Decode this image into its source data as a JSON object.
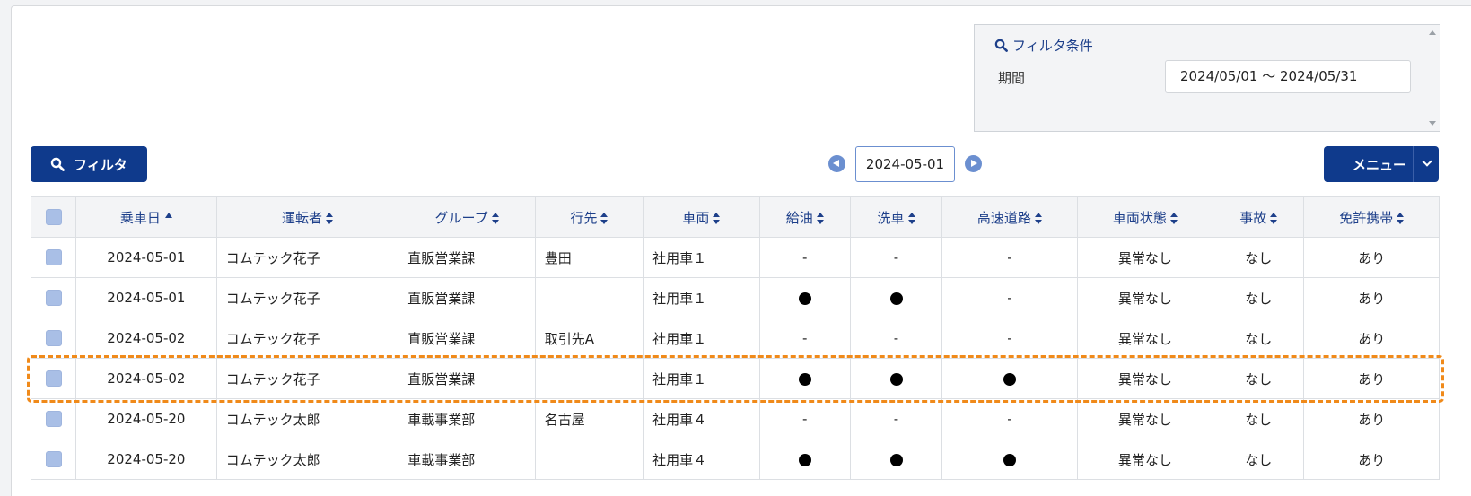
{
  "filter_panel": {
    "title": "フィルタ条件",
    "period_label": "期間",
    "period_value": "2024/05/01 〜 2024/05/31"
  },
  "toolbar": {
    "filter_button": "フィルタ",
    "current_date": "2024-05-01",
    "menu_button": "メニュー"
  },
  "table": {
    "headers": [
      "乗車日",
      "運転者",
      "グループ",
      "行先",
      "車両",
      "給油",
      "洗車",
      "高速道路",
      "車両状態",
      "事故",
      "免許携帯"
    ],
    "rows": [
      {
        "date": "2024-05-01",
        "driver": "コムテック花子",
        "group": "直販営業課",
        "destination": "豊田",
        "vehicle": "社用車１",
        "fuel": "-",
        "wash": "-",
        "highway": "-",
        "condition": "異常なし",
        "accident": "なし",
        "license": "あり"
      },
      {
        "date": "2024-05-01",
        "driver": "コムテック花子",
        "group": "直販営業課",
        "destination": "",
        "vehicle": "社用車１",
        "fuel": "●",
        "wash": "●",
        "highway": "-",
        "condition": "異常なし",
        "accident": "なし",
        "license": "あり"
      },
      {
        "date": "2024-05-02",
        "driver": "コムテック花子",
        "group": "直販営業課",
        "destination": "取引先A",
        "vehicle": "社用車１",
        "fuel": "-",
        "wash": "-",
        "highway": "-",
        "condition": "異常なし",
        "accident": "なし",
        "license": "あり"
      },
      {
        "date": "2024-05-02",
        "driver": "コムテック花子",
        "group": "直販営業課",
        "destination": "",
        "vehicle": "社用車１",
        "fuel": "●",
        "wash": "●",
        "highway": "●",
        "condition": "異常なし",
        "accident": "なし",
        "license": "あり"
      },
      {
        "date": "2024-05-20",
        "driver": "コムテック太郎",
        "group": "車載事業部",
        "destination": "名古屋",
        "vehicle": "社用車４",
        "fuel": "-",
        "wash": "-",
        "highway": "-",
        "condition": "異常なし",
        "accident": "なし",
        "license": "あり"
      },
      {
        "date": "2024-05-20",
        "driver": "コムテック太郎",
        "group": "車載事業部",
        "destination": "",
        "vehicle": "社用車４",
        "fuel": "●",
        "wash": "●",
        "highway": "●",
        "condition": "異常なし",
        "accident": "なし",
        "license": "あり"
      }
    ]
  },
  "colors": {
    "primary": "#0f3a8c",
    "header_text": "#1d3f8a",
    "highlight_border": "#f08a1a",
    "checkbox": "#a9bfe6"
  }
}
